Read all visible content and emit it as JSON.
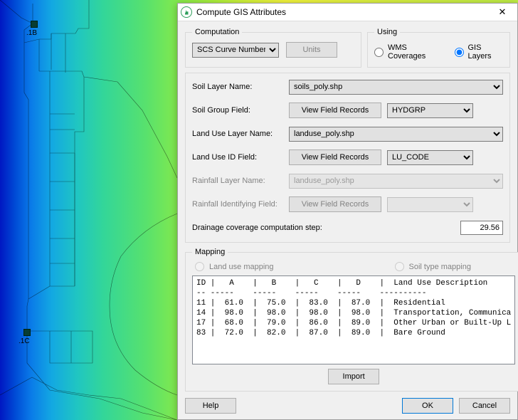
{
  "dialog": {
    "title": "Compute GIS Attributes",
    "close_symbol": "✕"
  },
  "computation": {
    "legend": "Computation",
    "selected": "SCS Curve Numbers",
    "units_label": "Units"
  },
  "using": {
    "legend": "Using",
    "option_wms": "WMS Coverages",
    "option_gis": "GIS Layers"
  },
  "fields": {
    "soil_layer_label": "Soil Layer Name:",
    "soil_layer_value": "soils_poly.shp",
    "soil_group_label": "Soil Group Field:",
    "view_records": "View Field Records",
    "soil_group_value": "HYDGRP",
    "landuse_layer_label": "Land Use Layer Name:",
    "landuse_layer_value": "landuse_poly.shp",
    "landuse_id_label": "Land Use ID Field:",
    "landuse_id_value": "LU_CODE",
    "rainfall_layer_label": "Rainfall Layer Name:",
    "rainfall_layer_value": "landuse_poly.shp",
    "rainfall_field_label": "Rainfall Identifying Field:",
    "drainage_label": "Drainage coverage computation step:",
    "drainage_value": "29.56"
  },
  "mapping": {
    "legend": "Mapping",
    "option_landuse": "Land use mapping",
    "option_soil": "Soil type mapping",
    "listing": "ID |   A    |   B    |   C    |   D    |  Land Use Description\n-- -----    -----    -----    -----    ----------\n11 |  61.0  |  75.0  |  83.0  |  87.0  |  Residential\n14 |  98.0  |  98.0  |  98.0  |  98.0  |  Transportation, Communica\n17 |  68.0  |  79.0  |  86.0  |  89.0  |  Other Urban or Built-Up L\n83 |  72.0  |  82.0  |  87.0  |  89.0  |  Bare Ground",
    "import_label": "Import"
  },
  "buttons": {
    "help": "Help",
    "ok": "OK",
    "cancel": "Cancel"
  },
  "map": {
    "label_1b": ".1B",
    "label_1c": ".1C"
  }
}
